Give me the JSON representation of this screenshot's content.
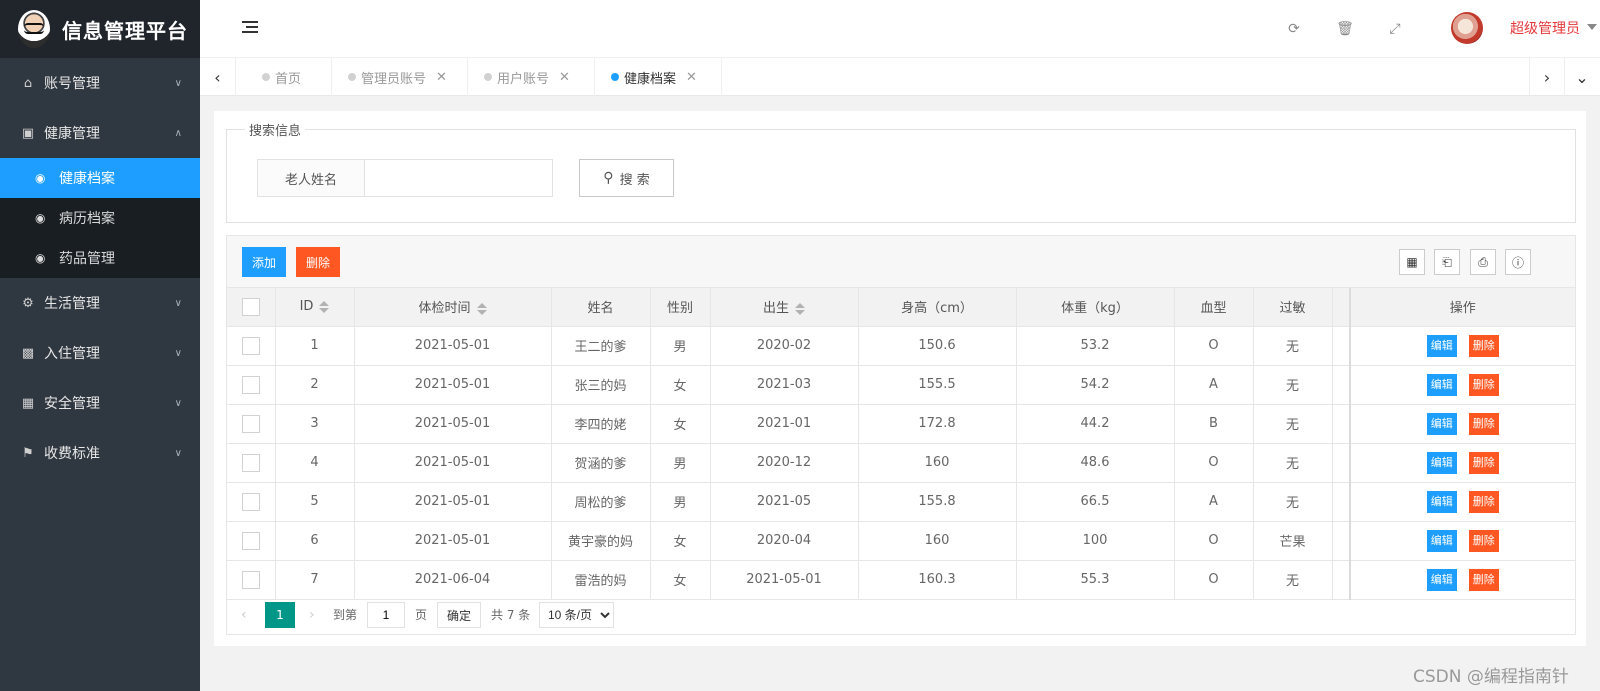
{
  "app": {
    "title": "信息管理平台"
  },
  "sidebar": {
    "items": [
      {
        "label": "账号管理",
        "icon": "home-icon",
        "arrow": "expand"
      },
      {
        "label": "健康管理",
        "icon": "window-icon",
        "arrow": "collapse",
        "children": [
          {
            "label": "健康档案",
            "active": true
          },
          {
            "label": "病历档案",
            "active": false
          },
          {
            "label": "药品管理",
            "active": false
          }
        ]
      },
      {
        "label": "生活管理",
        "icon": "gears-icon",
        "arrow": "expand"
      },
      {
        "label": "入住管理",
        "icon": "file-icon",
        "arrow": "expand"
      },
      {
        "label": "安全管理",
        "icon": "calendar-icon",
        "arrow": "expand"
      },
      {
        "label": "收费标准",
        "icon": "flag-icon",
        "arrow": "expand"
      }
    ]
  },
  "header": {
    "admin_name": "超级管理员"
  },
  "tabs": [
    {
      "label": "首页",
      "closable": false,
      "active": false
    },
    {
      "label": "管理员账号",
      "closable": true,
      "active": false
    },
    {
      "label": "用户账号",
      "closable": true,
      "active": false
    },
    {
      "label": "健康档案",
      "closable": true,
      "active": true
    }
  ],
  "search": {
    "legend": "搜索信息",
    "field_label": "老人姓名",
    "field_value": "",
    "button_label": "搜 索"
  },
  "toolbar": {
    "add_label": "添加",
    "delete_label": "删除"
  },
  "table": {
    "columns": [
      "ID",
      "体检时间",
      "姓名",
      "性别",
      "出生",
      "身高（cm）",
      "体重（kg）",
      "血型",
      "过敏",
      "操作"
    ],
    "edit_label": "编辑",
    "delete_label": "删除",
    "rows": [
      [
        "1",
        "2021-05-01",
        "王二的爹",
        "男",
        "2020-02",
        "150.6",
        "53.2",
        "O",
        "无"
      ],
      [
        "2",
        "2021-05-01",
        "张三的妈",
        "女",
        "2021-03",
        "155.5",
        "54.2",
        "A",
        "无"
      ],
      [
        "3",
        "2021-05-01",
        "李四的姥",
        "女",
        "2021-01",
        "172.8",
        "44.2",
        "B",
        "无"
      ],
      [
        "4",
        "2021-05-01",
        "贺涵的爹",
        "男",
        "2020-12",
        "160",
        "48.6",
        "O",
        "无"
      ],
      [
        "5",
        "2021-05-01",
        "周松的爹",
        "男",
        "2021-05",
        "155.8",
        "66.5",
        "A",
        "无"
      ],
      [
        "6",
        "2021-05-01",
        "黄宇豪的妈",
        "女",
        "2020-04",
        "160",
        "100",
        "O",
        "芒果"
      ],
      [
        "7",
        "2021-06-04",
        "雷浩的妈",
        "女",
        "2021-05-01",
        "160.3",
        "55.3",
        "O",
        "无"
      ]
    ]
  },
  "pager": {
    "current_page": "1",
    "goto_label": "到第",
    "goto_value": "1",
    "page_suffix": "页",
    "confirm_label": "确定",
    "total_text": "共 7 条",
    "page_size_option": "10 条/页"
  },
  "watermark": "CSDN @编程指南针"
}
